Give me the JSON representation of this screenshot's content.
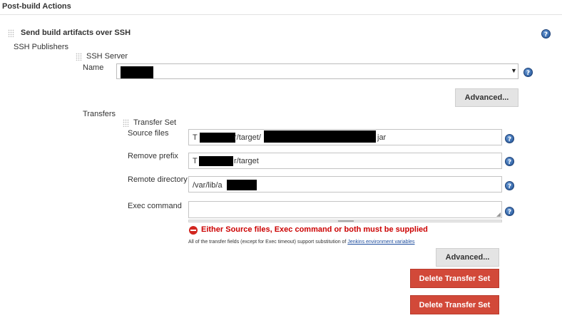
{
  "section": {
    "title": "Post-build Actions"
  },
  "plugin": {
    "title": "Send build artifacts over SSH"
  },
  "ssh_publishers": {
    "label": "SSH Publishers"
  },
  "ssh_server": {
    "title": "SSH Server",
    "name_label": "Name",
    "name_value": "",
    "advanced_label": "Advanced..."
  },
  "transfers": {
    "label": "Transfers",
    "set_title": "Transfer Set",
    "source_files_label": "Source files",
    "source_files_value": [
      "T",
      "r/target/",
      "jar"
    ],
    "remove_prefix_label": "Remove prefix",
    "remove_prefix_value": [
      "T",
      "r/target"
    ],
    "remote_directory_label": "Remote directory",
    "remote_directory_value": "/var/lib/a",
    "exec_command_label": "Exec command",
    "exec_command_value": "",
    "error": "Either Source files, Exec command or both must be supplied",
    "note_prefix": "All of the transfer fields (except for Exec timeout) support substitution of ",
    "note_link": "Jenkins environment variables",
    "advanced_label": "Advanced...",
    "delete_label": "Delete Transfer Set"
  },
  "icons": {
    "help": "help-icon",
    "grip": "drag-handle-icon",
    "error": "error-icon",
    "dropdown": "dropdown-arrow-icon"
  }
}
